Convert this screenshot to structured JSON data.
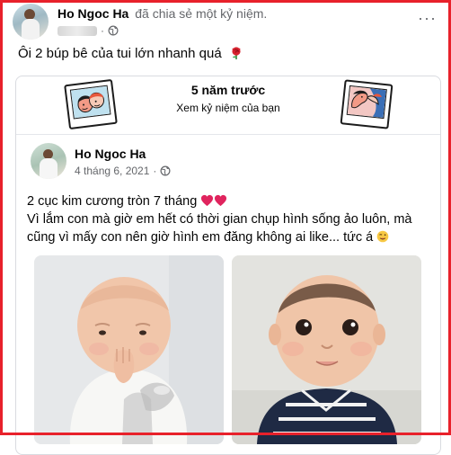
{
  "post": {
    "author": "Ho Ngoc Ha",
    "action": "đã chia sẻ một kỷ niệm.",
    "separator": "·",
    "more": "···",
    "caption": "Ôi 2 búp bê của tui lớn nhanh quá"
  },
  "memory": {
    "title": "5 năm trước",
    "subtitle": "Xem kỷ niệm của bạn"
  },
  "shared_post": {
    "author": "Ho Ngoc Ha",
    "date": "4 tháng 6, 2021",
    "separator": "·",
    "line1": "2 cục kim cương tròn 7 tháng",
    "line2": "Vì lắm con mà giờ em hết có thời gian chụp hình sống ảo luôn, mà",
    "line3": "cũng vì mấy con nên giờ hình em đăng không ai like... tức á"
  },
  "icons": {
    "globe": "globe-icon",
    "rose": "rose-icon",
    "heart": "heart-icon",
    "wink": "wink-emoji-icon"
  },
  "colors": {
    "frame": "#e8212b",
    "secondary_text": "#65676b",
    "heart": "#e0245e"
  }
}
